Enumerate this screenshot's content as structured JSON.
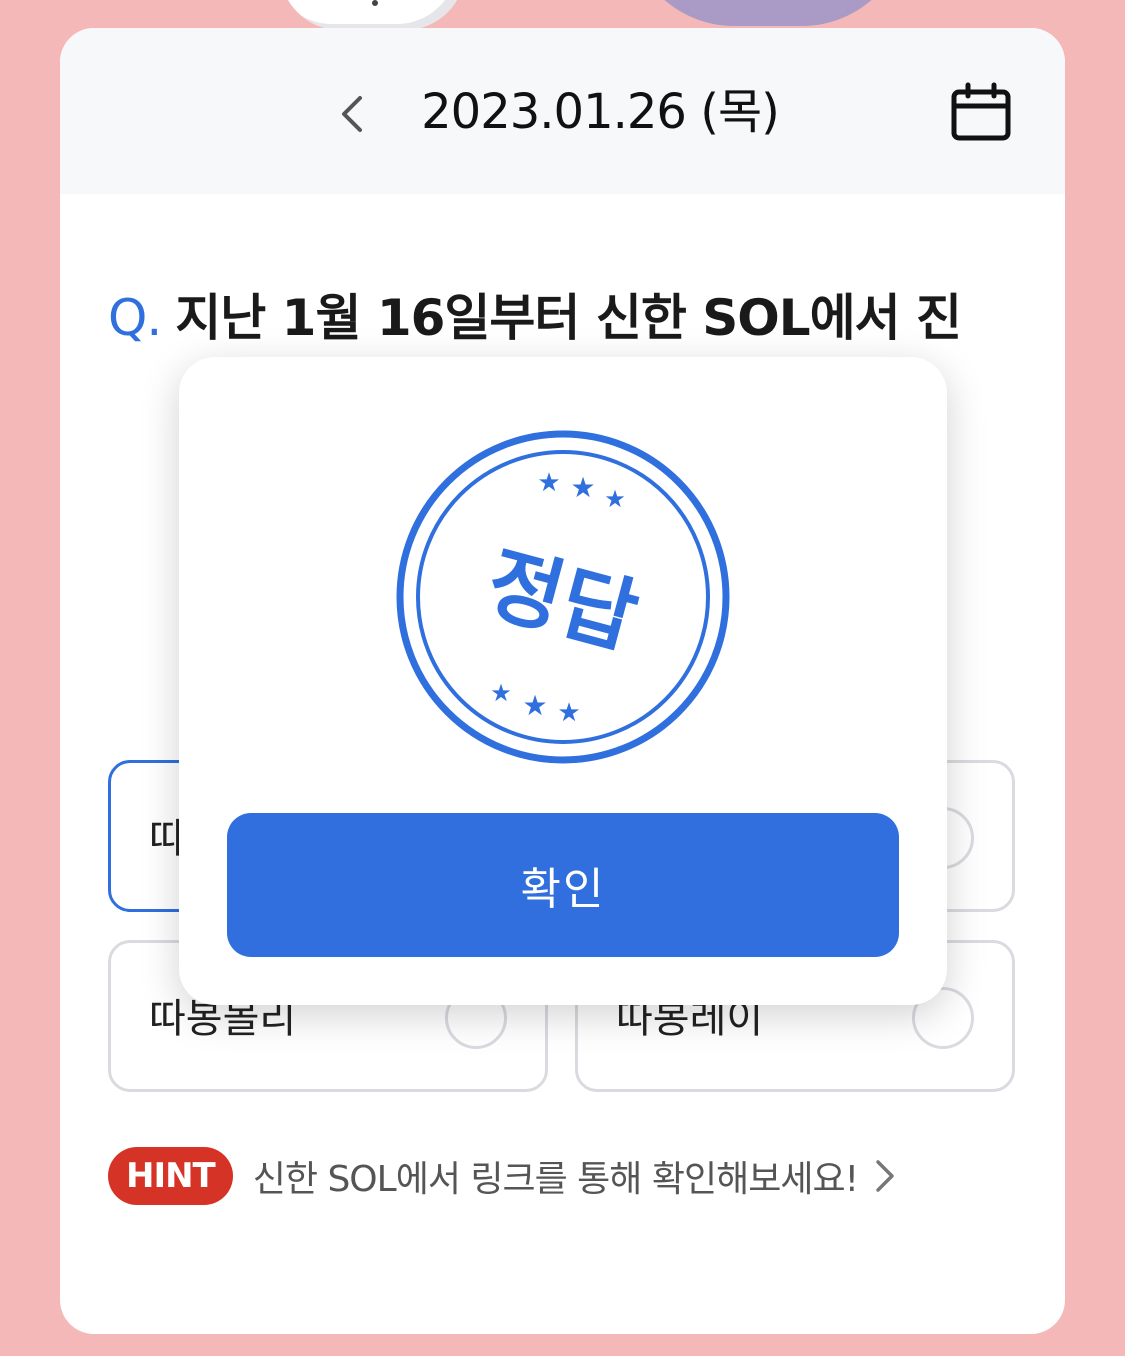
{
  "header": {
    "date": "2023.01.26 (목)",
    "prev_icon": "chevron-left-icon",
    "calendar_icon": "calendar-icon"
  },
  "question": {
    "prefix": "Q.",
    "text": "지난 1월 16일부터 신한 SOL에서 진"
  },
  "options": [
    {
      "label": "따",
      "selected": true
    },
    {
      "label": "",
      "selected": false
    },
    {
      "label": "따봉몰리",
      "selected": false
    },
    {
      "label": "따봉레이",
      "selected": false
    }
  ],
  "hint": {
    "badge": "HINT",
    "text": "신한 SOL에서 링크를 통해 확인해보세요!",
    "arrow_icon": "chevron-right-icon"
  },
  "modal": {
    "stamp_text": "정답",
    "stamp_icon": "correct-answer-stamp",
    "confirm_label": "확인"
  },
  "colors": {
    "background": "#f4b8b8",
    "accent": "#2f6fde",
    "hint_badge": "#d43325"
  }
}
